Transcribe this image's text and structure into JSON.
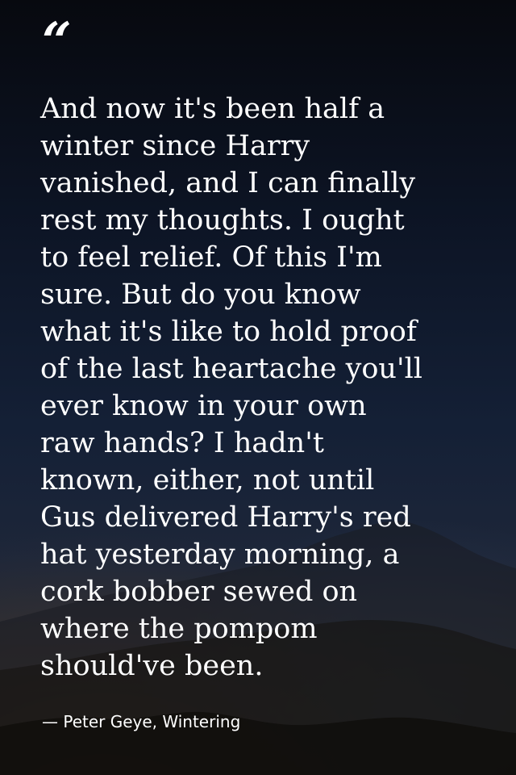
{
  "quote": {
    "mark": "“",
    "lines": [
      "And now it's been half a",
      "winter since Harry",
      "vanished, and I can finally",
      "rest my thoughts. I ought",
      "to feel relief. Of this I'm",
      "sure. But do you know",
      "what it's like to hold proof",
      "of the last heartache you'll",
      "ever know in your own",
      "raw hands? I hadn't",
      "known, either, not until",
      "Gus delivered Harry's red",
      "hat yesterday morning, a",
      "cork bobber sewed on",
      "where the pompom",
      "should've been."
    ],
    "attribution": "— Peter Geye, Wintering"
  },
  "colors": {
    "text": "#ffffff",
    "sky_top": "#07090f",
    "sky_mid": "#142036",
    "horizon_glow": "#96693c"
  }
}
